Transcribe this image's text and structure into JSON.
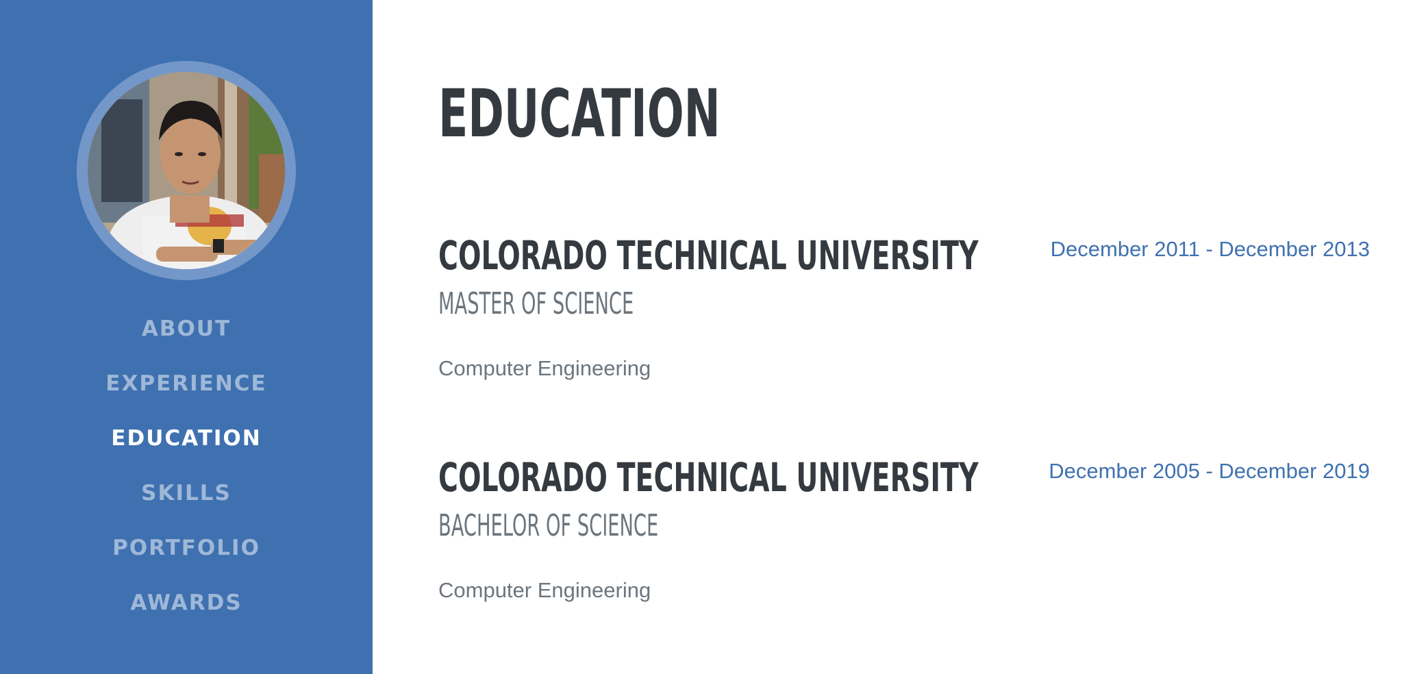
{
  "sidebar": {
    "profile_image": "profile-photo",
    "nav": [
      {
        "label": "ABOUT"
      },
      {
        "label": "EXPERIENCE"
      },
      {
        "label": "EDUCATION"
      },
      {
        "label": "SKILLS"
      },
      {
        "label": "PORTFOLIO"
      },
      {
        "label": "AWARDS"
      }
    ],
    "active_item": "EDUCATION",
    "colors": {
      "background": "#3f71b0",
      "active_text": "#ffffff"
    }
  },
  "main": {
    "title": "EDUCATION",
    "entries": [
      {
        "school": "COLORADO TECHNICAL UNIVERSITY",
        "degree": "MASTER OF SCIENCE",
        "field": "Computer Engineering",
        "dates": "December 2011 - December 2013"
      },
      {
        "school": "COLORADO TECHNICAL UNIVERSITY",
        "degree": "BACHELOR OF SCIENCE",
        "field": "Computer Engineering",
        "dates": "December 2005 - December 2019"
      }
    ],
    "colors": {
      "heading": "#343a40",
      "muted": "#6c757d",
      "accent": "#3f71b0"
    }
  }
}
